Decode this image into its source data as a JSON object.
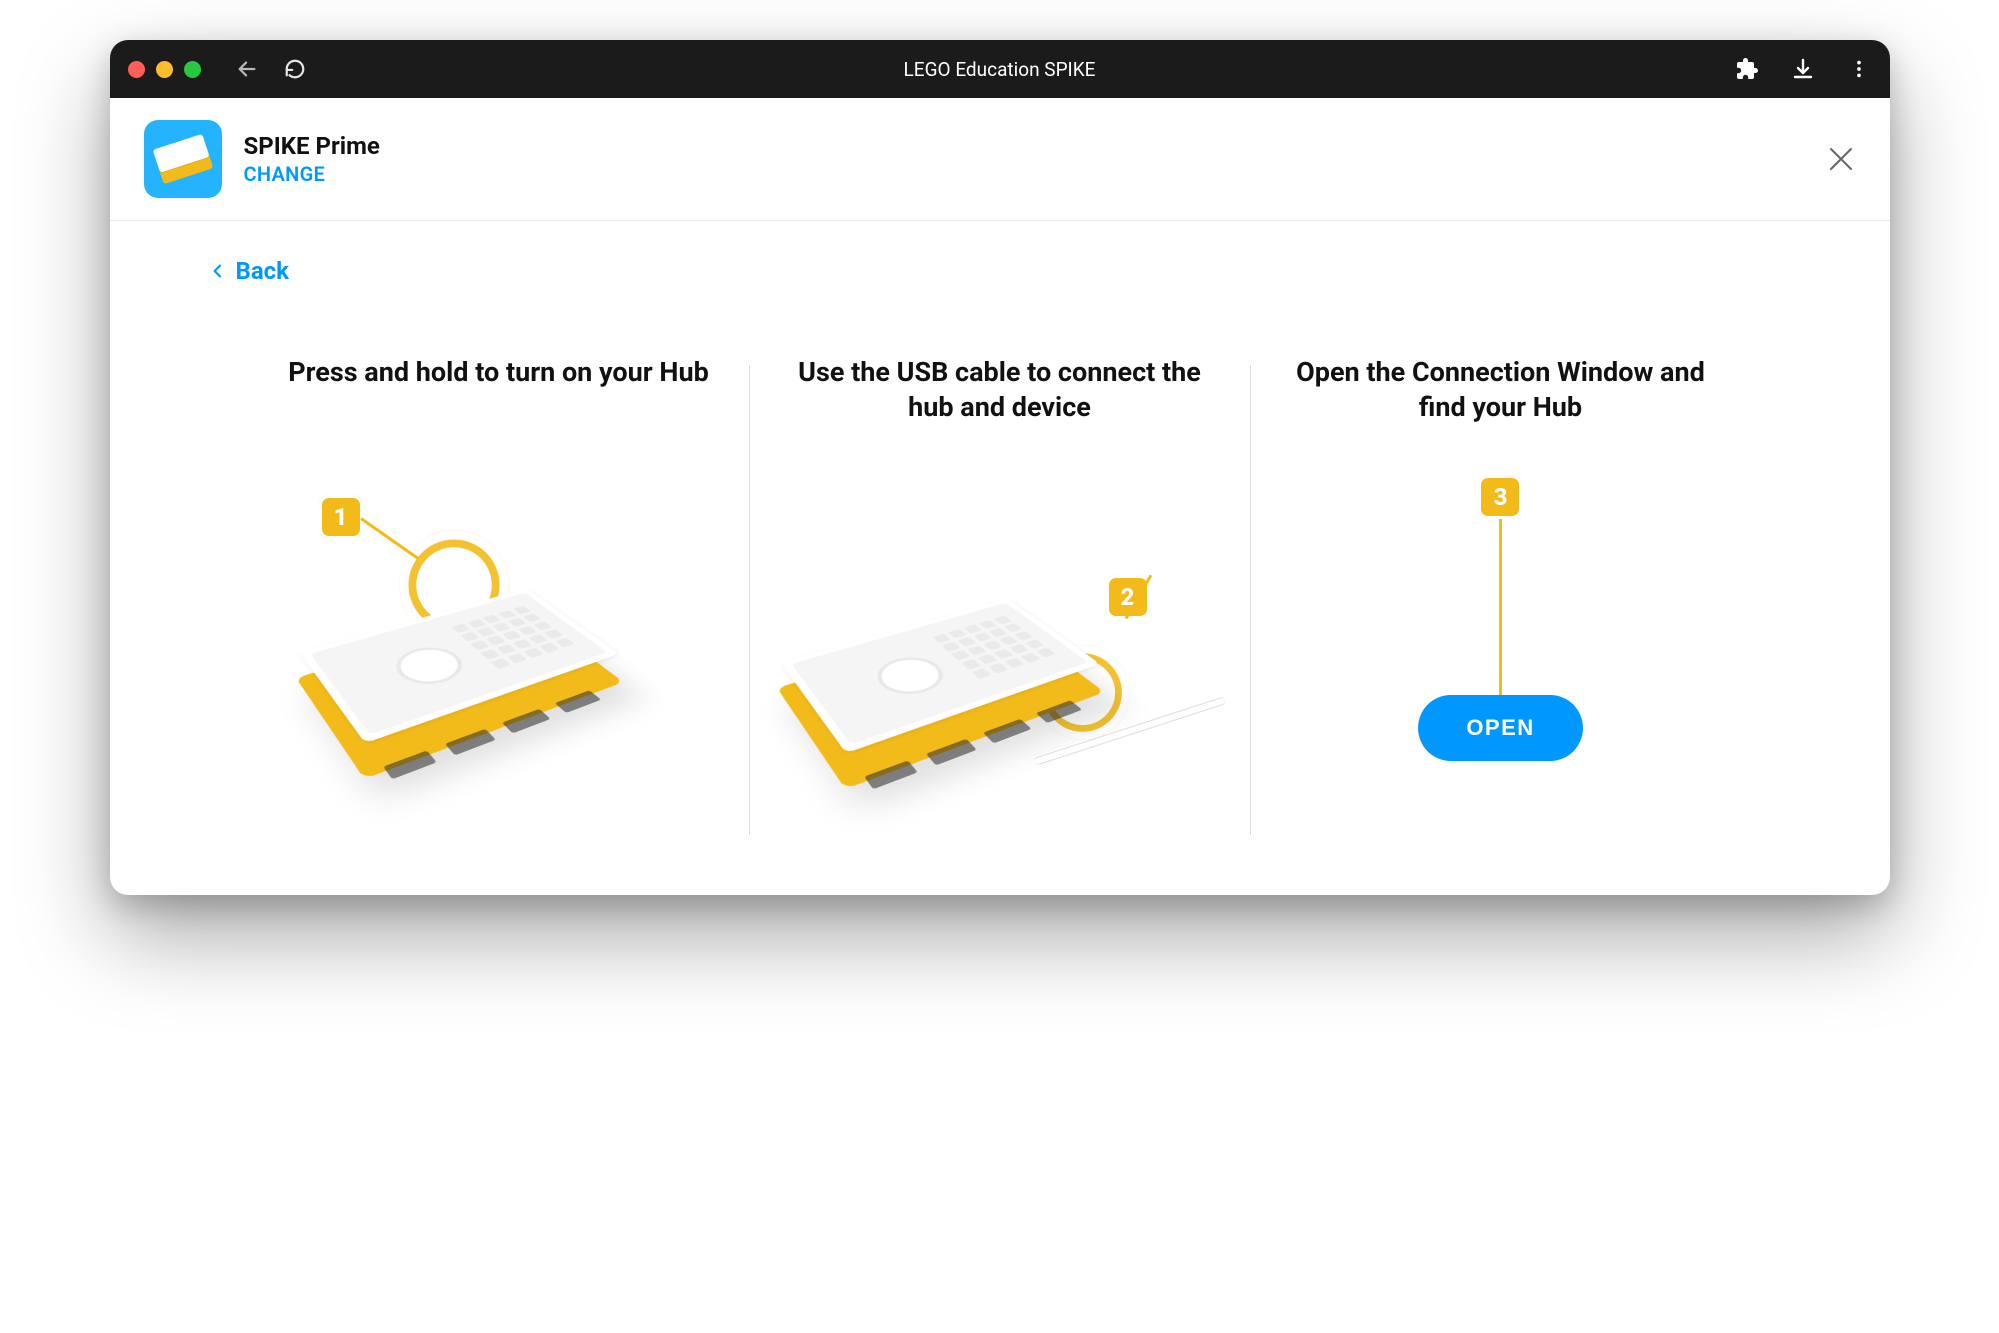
{
  "window": {
    "title": "LEGO Education SPIKE"
  },
  "header": {
    "product_name": "SPIKE Prime",
    "change_label": "CHANGE"
  },
  "back": {
    "label": "Back"
  },
  "steps": {
    "step1": {
      "title": "Press and hold to turn on your Hub",
      "badge": "1"
    },
    "step2": {
      "title": "Use the USB cable to connect the hub and device",
      "badge": "2"
    },
    "step3": {
      "title": "Open the Connection Window and find your Hub",
      "badge": "3",
      "button_label": "OPEN"
    }
  },
  "colors": {
    "accent_blue": "#0098ff",
    "accent_yellow": "#f3bb1a"
  }
}
